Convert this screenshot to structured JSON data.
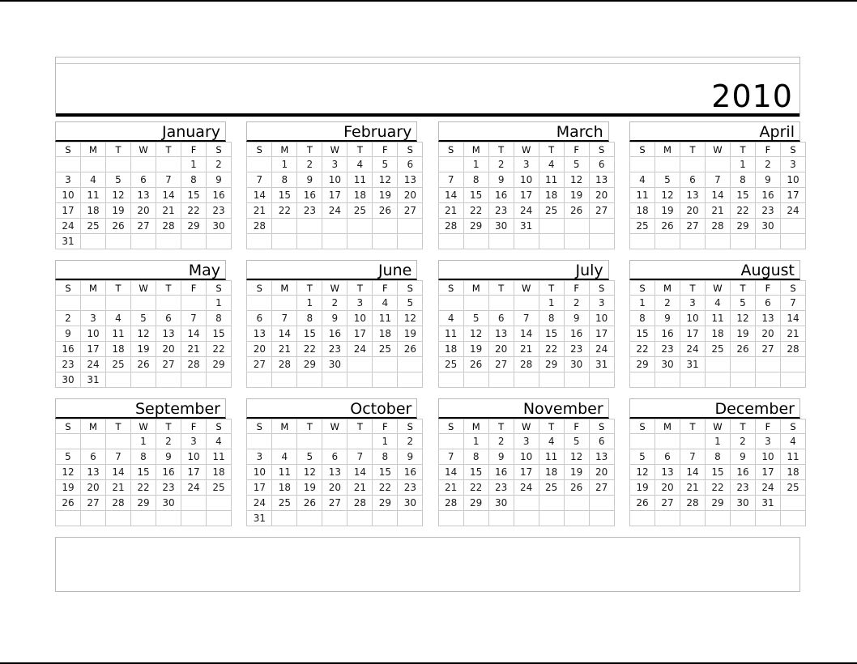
{
  "header": {
    "year": "2010"
  },
  "weekdays": [
    "S",
    "M",
    "T",
    "W",
    "T",
    "F",
    "S"
  ],
  "colors": {
    "page_background": "#ffffff",
    "page_rule": "#000000",
    "grid_line": "#c9c9c9",
    "panel_border": "#b8b8b8",
    "month_underline": "#000000",
    "text": "#000000"
  },
  "rows": [
    {
      "months": [
        {
          "name": "January",
          "first_weekday": 5,
          "days_in_month": 31,
          "weeks": [
            [
              "",
              "",
              "",
              "",
              "",
              "1",
              "2"
            ],
            [
              "3",
              "4",
              "5",
              "6",
              "7",
              "8",
              "9"
            ],
            [
              "10",
              "11",
              "12",
              "13",
              "14",
              "15",
              "16"
            ],
            [
              "17",
              "18",
              "19",
              "20",
              "21",
              "22",
              "23"
            ],
            [
              "24",
              "25",
              "26",
              "27",
              "28",
              "29",
              "30"
            ],
            [
              "31",
              "",
              "",
              "",
              "",
              "",
              ""
            ]
          ]
        },
        {
          "name": "February",
          "first_weekday": 1,
          "days_in_month": 28,
          "weeks": [
            [
              "",
              "1",
              "2",
              "3",
              "4",
              "5",
              "6"
            ],
            [
              "7",
              "8",
              "9",
              "10",
              "11",
              "12",
              "13"
            ],
            [
              "14",
              "15",
              "16",
              "17",
              "18",
              "19",
              "20"
            ],
            [
              "21",
              "22",
              "23",
              "24",
              "25",
              "26",
              "27"
            ],
            [
              "28",
              "",
              "",
              "",
              "",
              "",
              ""
            ],
            [
              "",
              "",
              "",
              "",
              "",
              "",
              ""
            ]
          ]
        },
        {
          "name": "March",
          "first_weekday": 1,
          "days_in_month": 31,
          "weeks": [
            [
              "",
              "1",
              "2",
              "3",
              "4",
              "5",
              "6"
            ],
            [
              "7",
              "8",
              "9",
              "10",
              "11",
              "12",
              "13"
            ],
            [
              "14",
              "15",
              "16",
              "17",
              "18",
              "19",
              "20"
            ],
            [
              "21",
              "22",
              "23",
              "24",
              "25",
              "26",
              "27"
            ],
            [
              "28",
              "29",
              "30",
              "31",
              "",
              "",
              ""
            ],
            [
              "",
              "",
              "",
              "",
              "",
              "",
              ""
            ]
          ]
        },
        {
          "name": "April",
          "first_weekday": 4,
          "days_in_month": 30,
          "weeks": [
            [
              "",
              "",
              "",
              "",
              "1",
              "2",
              "3"
            ],
            [
              "4",
              "5",
              "6",
              "7",
              "8",
              "9",
              "10"
            ],
            [
              "11",
              "12",
              "13",
              "14",
              "15",
              "16",
              "17"
            ],
            [
              "18",
              "19",
              "20",
              "21",
              "22",
              "23",
              "24"
            ],
            [
              "25",
              "26",
              "27",
              "28",
              "29",
              "30",
              ""
            ],
            [
              "",
              "",
              "",
              "",
              "",
              "",
              ""
            ]
          ]
        }
      ]
    },
    {
      "months": [
        {
          "name": "May",
          "first_weekday": 6,
          "days_in_month": 31,
          "weeks": [
            [
              "",
              "",
              "",
              "",
              "",
              "",
              "1"
            ],
            [
              "2",
              "3",
              "4",
              "5",
              "6",
              "7",
              "8"
            ],
            [
              "9",
              "10",
              "11",
              "12",
              "13",
              "14",
              "15"
            ],
            [
              "16",
              "17",
              "18",
              "19",
              "20",
              "21",
              "22"
            ],
            [
              "23",
              "24",
              "25",
              "26",
              "27",
              "28",
              "29"
            ],
            [
              "30",
              "31",
              "",
              "",
              "",
              "",
              ""
            ]
          ]
        },
        {
          "name": "June",
          "first_weekday": 2,
          "days_in_month": 30,
          "weeks": [
            [
              "",
              "",
              "1",
              "2",
              "3",
              "4",
              "5"
            ],
            [
              "6",
              "7",
              "8",
              "9",
              "10",
              "11",
              "12"
            ],
            [
              "13",
              "14",
              "15",
              "16",
              "17",
              "18",
              "19"
            ],
            [
              "20",
              "21",
              "22",
              "23",
              "24",
              "25",
              "26"
            ],
            [
              "27",
              "28",
              "29",
              "30",
              "",
              "",
              ""
            ],
            [
              "",
              "",
              "",
              "",
              "",
              "",
              ""
            ]
          ]
        },
        {
          "name": "July",
          "first_weekday": 4,
          "days_in_month": 31,
          "weeks": [
            [
              "",
              "",
              "",
              "",
              "1",
              "2",
              "3"
            ],
            [
              "4",
              "5",
              "6",
              "7",
              "8",
              "9",
              "10"
            ],
            [
              "11",
              "12",
              "13",
              "14",
              "15",
              "16",
              "17"
            ],
            [
              "18",
              "19",
              "20",
              "21",
              "22",
              "23",
              "24"
            ],
            [
              "25",
              "26",
              "27",
              "28",
              "29",
              "30",
              "31"
            ],
            [
              "",
              "",
              "",
              "",
              "",
              "",
              ""
            ]
          ]
        },
        {
          "name": "August",
          "first_weekday": 0,
          "days_in_month": 31,
          "weeks": [
            [
              "1",
              "2",
              "3",
              "4",
              "5",
              "6",
              "7"
            ],
            [
              "8",
              "9",
              "10",
              "11",
              "12",
              "13",
              "14"
            ],
            [
              "15",
              "16",
              "17",
              "18",
              "19",
              "20",
              "21"
            ],
            [
              "22",
              "23",
              "24",
              "25",
              "26",
              "27",
              "28"
            ],
            [
              "29",
              "30",
              "31",
              "",
              "",
              "",
              ""
            ],
            [
              "",
              "",
              "",
              "",
              "",
              "",
              ""
            ]
          ]
        }
      ]
    },
    {
      "months": [
        {
          "name": "September",
          "first_weekday": 3,
          "days_in_month": 30,
          "weeks": [
            [
              "",
              "",
              "",
              "1",
              "2",
              "3",
              "4"
            ],
            [
              "5",
              "6",
              "7",
              "8",
              "9",
              "10",
              "11"
            ],
            [
              "12",
              "13",
              "14",
              "15",
              "16",
              "17",
              "18"
            ],
            [
              "19",
              "20",
              "21",
              "22",
              "23",
              "24",
              "25"
            ],
            [
              "26",
              "27",
              "28",
              "29",
              "30",
              "",
              ""
            ],
            [
              "",
              "",
              "",
              "",
              "",
              "",
              ""
            ]
          ]
        },
        {
          "name": "October",
          "first_weekday": 5,
          "days_in_month": 31,
          "weeks": [
            [
              "",
              "",
              "",
              "",
              "",
              "1",
              "2"
            ],
            [
              "3",
              "4",
              "5",
              "6",
              "7",
              "8",
              "9"
            ],
            [
              "10",
              "11",
              "12",
              "13",
              "14",
              "15",
              "16"
            ],
            [
              "17",
              "18",
              "19",
              "20",
              "21",
              "22",
              "23"
            ],
            [
              "24",
              "25",
              "26",
              "27",
              "28",
              "29",
              "30"
            ],
            [
              "31",
              "",
              "",
              "",
              "",
              "",
              ""
            ]
          ]
        },
        {
          "name": "November",
          "first_weekday": 1,
          "days_in_month": 30,
          "weeks": [
            [
              "",
              "1",
              "2",
              "3",
              "4",
              "5",
              "6"
            ],
            [
              "7",
              "8",
              "9",
              "10",
              "11",
              "12",
              "13"
            ],
            [
              "14",
              "15",
              "16",
              "17",
              "18",
              "19",
              "20"
            ],
            [
              "21",
              "22",
              "23",
              "24",
              "25",
              "26",
              "27"
            ],
            [
              "28",
              "29",
              "30",
              "",
              "",
              "",
              ""
            ],
            [
              "",
              "",
              "",
              "",
              "",
              "",
              ""
            ]
          ]
        },
        {
          "name": "December",
          "first_weekday": 3,
          "days_in_month": 31,
          "weeks": [
            [
              "",
              "",
              "",
              "1",
              "2",
              "3",
              "4"
            ],
            [
              "5",
              "6",
              "7",
              "8",
              "9",
              "10",
              "11"
            ],
            [
              "12",
              "13",
              "14",
              "15",
              "16",
              "17",
              "18"
            ],
            [
              "19",
              "20",
              "21",
              "22",
              "23",
              "24",
              "25"
            ],
            [
              "26",
              "27",
              "28",
              "29",
              "30",
              "31",
              ""
            ],
            [
              "",
              "",
              "",
              "",
              "",
              "",
              ""
            ]
          ]
        }
      ]
    }
  ]
}
